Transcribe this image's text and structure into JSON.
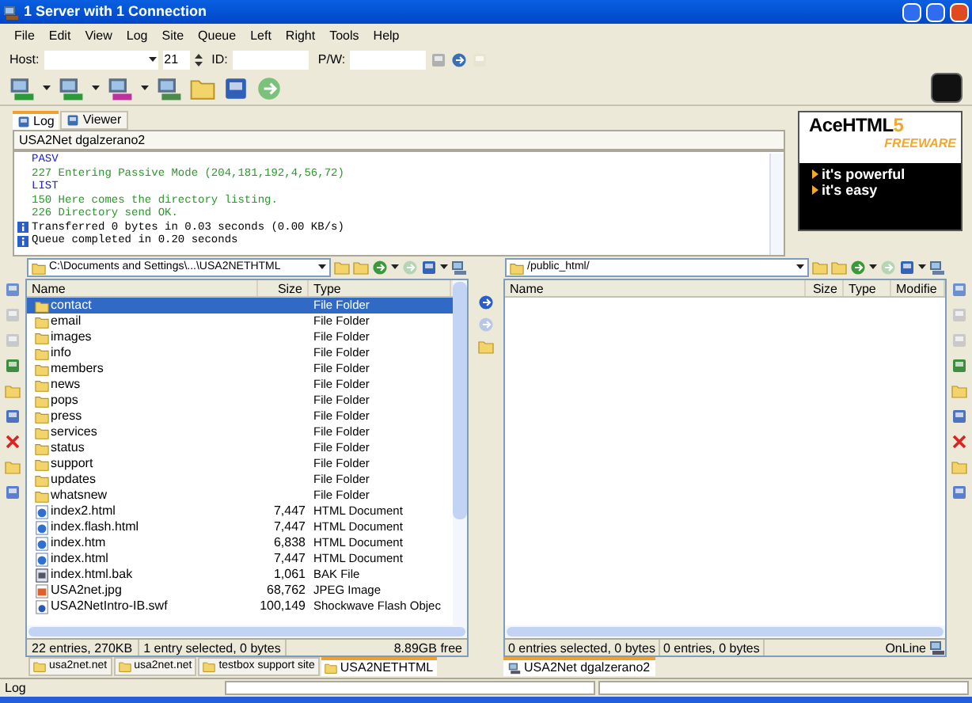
{
  "window": {
    "title": "1 Server with 1 Connection"
  },
  "menu": [
    "File",
    "Edit",
    "View",
    "Log",
    "Site",
    "Queue",
    "Left",
    "Right",
    "Tools",
    "Help"
  ],
  "host_bar": {
    "host_label": "Host:",
    "port": "21",
    "id_label": "ID:",
    "pw_label": "P/W:"
  },
  "log": {
    "tabs": [
      {
        "label": "Log",
        "selected": true
      },
      {
        "label": "Viewer",
        "selected": false
      }
    ],
    "connection": "USA2Net dgalzerano2",
    "lines": [
      {
        "kind": "command",
        "text": "PASV"
      },
      {
        "kind": "response",
        "text": "227 Entering Passive Mode (204,181,192,4,56,72)"
      },
      {
        "kind": "command",
        "text": "LIST"
      },
      {
        "kind": "response",
        "text": "150 Here comes the directory listing."
      },
      {
        "kind": "response",
        "text": "226 Directory send OK."
      },
      {
        "kind": "info",
        "text": "Transferred 0 bytes in 0.03 seconds (0.00 KB/s)"
      },
      {
        "kind": "info",
        "text": "Queue completed in 0.20 seconds"
      }
    ]
  },
  "ad": {
    "title": "AceHTML",
    "title_accent": "5",
    "subtitle": "FREEWARE",
    "bullets": [
      "it's powerful",
      "it's easy"
    ]
  },
  "left_pane": {
    "path": "C:\\Documents and Settings\\...\\USA2NETHTML",
    "columns": [
      "Name",
      "Size",
      "Type"
    ],
    "rows": [
      {
        "kind": "folder",
        "name": "contact",
        "size": "",
        "type": "File Folder",
        "selected": true
      },
      {
        "kind": "folder",
        "name": "email",
        "type": "File Folder",
        "selected": false
      },
      {
        "kind": "folder",
        "name": "images",
        "type": "File Folder",
        "selected": false
      },
      {
        "kind": "folder",
        "name": "info",
        "type": "File Folder",
        "selected": false
      },
      {
        "kind": "folder",
        "name": "members",
        "type": "File Folder",
        "selected": false
      },
      {
        "kind": "folder",
        "name": "news",
        "type": "File Folder",
        "selected": false
      },
      {
        "kind": "folder",
        "name": "pops",
        "type": "File Folder",
        "selected": false
      },
      {
        "kind": "folder",
        "name": "press",
        "type": "File Folder",
        "selected": false
      },
      {
        "kind": "folder",
        "name": "services",
        "type": "File Folder",
        "selected": false
      },
      {
        "kind": "folder",
        "name": "status",
        "type": "File Folder",
        "selected": false
      },
      {
        "kind": "folder",
        "name": "support",
        "type": "File Folder",
        "selected": false
      },
      {
        "kind": "folder",
        "name": "updates",
        "type": "File Folder",
        "selected": false
      },
      {
        "kind": "folder",
        "name": "whatsnew",
        "type": "File Folder",
        "selected": false
      },
      {
        "kind": "html",
        "name": "index2.html",
        "size": "7,447",
        "type": "HTML Document",
        "selected": false
      },
      {
        "kind": "html",
        "name": "index.flash.html",
        "size": "7,447",
        "type": "HTML Document",
        "selected": false
      },
      {
        "kind": "html",
        "name": "index.htm",
        "size": "6,838",
        "type": "HTML Document",
        "selected": false
      },
      {
        "kind": "html",
        "name": "index.html",
        "size": "7,447",
        "type": "HTML Document",
        "selected": false
      },
      {
        "kind": "bak",
        "name": "index.html.bak",
        "size": "1,061",
        "type": "BAK File",
        "selected": false
      },
      {
        "kind": "image",
        "name": "USA2net.jpg",
        "size": "68,762",
        "type": "JPEG Image",
        "selected": false
      },
      {
        "kind": "flash",
        "name": "USA2NetIntro-IB.swf",
        "size": "100,149",
        "type": "Shockwave Flash Objec",
        "selected": false
      }
    ],
    "status": [
      "22 entries, 270KB",
      "1 entry selected, 0 bytes",
      "8.89GB free"
    ],
    "tabs": [
      {
        "label": "usa2net.net",
        "selected": false
      },
      {
        "label": "usa2net.net",
        "selected": false
      },
      {
        "label": "testbox support site",
        "selected": false
      },
      {
        "label": "USA2NETHTML",
        "selected": true
      }
    ]
  },
  "right_pane": {
    "path": "/public_html/",
    "columns": [
      "Name",
      "Size",
      "Type",
      "Modifie"
    ],
    "status": [
      "0 entries selected, 0 bytes",
      "0 entries, 0 bytes",
      "OnLine"
    ],
    "tabs": [
      {
        "label": "USA2Net dgalzerano2",
        "selected": true
      }
    ]
  },
  "status_bar": {
    "text": "Log"
  }
}
